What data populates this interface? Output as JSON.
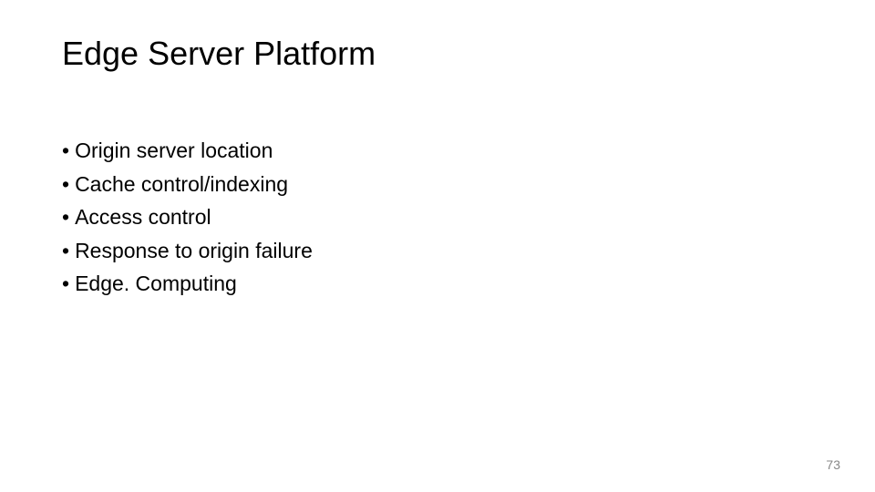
{
  "slide": {
    "title": "Edge Server Platform",
    "bullets": [
      "Origin server location",
      "Cache control/indexing",
      "Access control",
      "Response to origin failure",
      "Edge. Computing"
    ],
    "page_number": "73"
  }
}
